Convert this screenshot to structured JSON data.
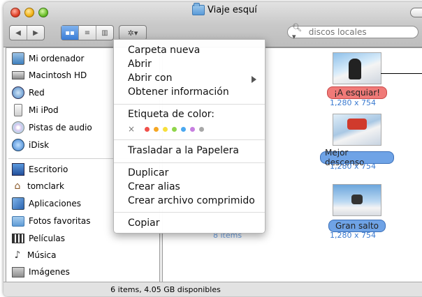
{
  "window": {
    "title": "Viaje esquí"
  },
  "toolbar": {
    "back": "◀",
    "forward": "▶",
    "view_icons": "▪▪",
    "view_list": "≡",
    "view_columns": "▥",
    "action": "✲▾",
    "search_placeholder": "discos locales"
  },
  "sidebar": {
    "devices": [
      {
        "label": "Mi ordenador",
        "icon": "computer-icon"
      },
      {
        "label": "Macintosh HD",
        "icon": "harddisk-icon"
      },
      {
        "label": "Red",
        "icon": "network-icon"
      },
      {
        "label": "Mi iPod",
        "icon": "ipod-icon"
      },
      {
        "label": "Pistas de audio",
        "icon": "cd-icon"
      },
      {
        "label": "iDisk",
        "icon": "idisk-icon"
      }
    ],
    "places": [
      {
        "label": "Escritorio",
        "icon": "desktop-icon"
      },
      {
        "label": "tomclark",
        "icon": "home-icon"
      },
      {
        "label": "Aplicaciones",
        "icon": "applications-icon"
      },
      {
        "label": "Fotos favoritas",
        "icon": "folder-icon"
      },
      {
        "label": "Películas",
        "icon": "movies-icon"
      },
      {
        "label": "Música",
        "icon": "music-icon"
      },
      {
        "label": "Imágenes",
        "icon": "pictures-icon"
      }
    ]
  },
  "files": [
    {
      "label": "¡A esquiar!",
      "dims": "1,280 x 754",
      "color": "#f07a78"
    },
    {
      "label": "Mejor descenso",
      "dims": "1,280 x 754",
      "color": "#6fa3e6"
    },
    {
      "label": "Gran salto",
      "dims": "1,280 x 754",
      "color": "#6fa3e6"
    }
  ],
  "hidden_count": "8 items",
  "menu": {
    "new_folder": "Carpeta nueva",
    "open": "Abrir",
    "open_with": "Abrir con",
    "get_info": "Obtener información",
    "color_label": "Etiqueta de color:",
    "color_none": "×",
    "colors": [
      "#f0504a",
      "#f5a623",
      "#f7df3a",
      "#8fd54a",
      "#4aa8f0",
      "#c77fe0",
      "#a8a8a8"
    ],
    "move_to_trash": "Trasladar a la Papelera",
    "duplicate": "Duplicar",
    "make_alias": "Crear alias",
    "create_archive": "Crear archivo comprimido",
    "copy": "Copiar"
  },
  "status": {
    "text": "6 items, 4.05 GB disponibles"
  }
}
